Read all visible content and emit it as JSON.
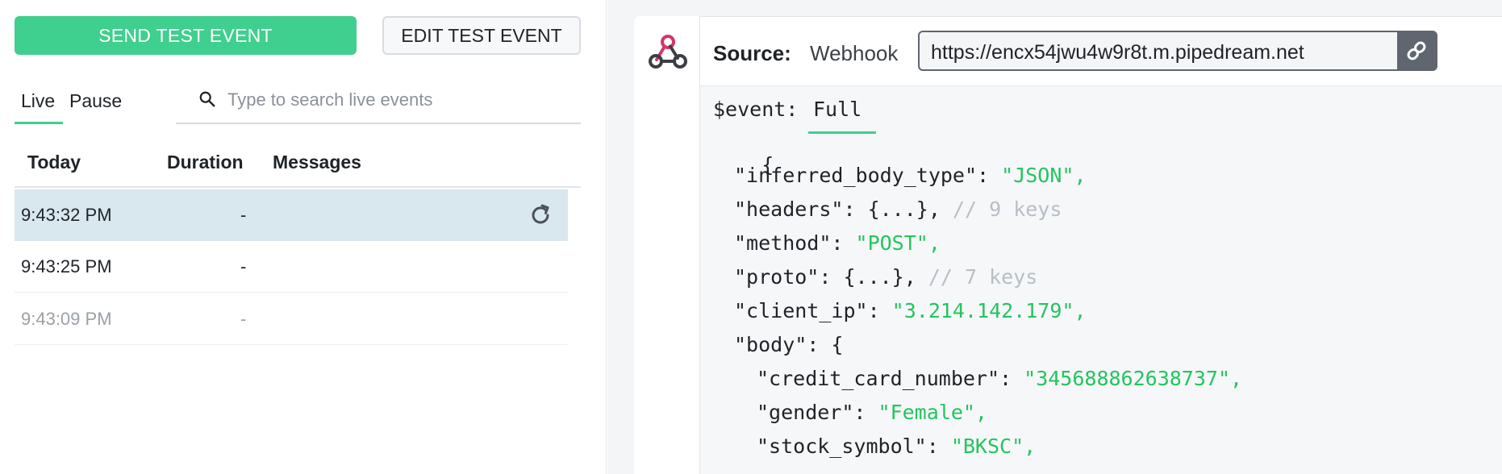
{
  "toolbar": {
    "send_label": "SEND TEST EVENT",
    "edit_label": "EDIT TEST EVENT"
  },
  "tabs": {
    "live": "Live",
    "pause": "Pause",
    "active": "Live"
  },
  "search": {
    "placeholder": "Type to search live events"
  },
  "events_table": {
    "headers": [
      "Today",
      "Duration",
      "Messages"
    ],
    "rows": [
      {
        "time": "9:43:32 PM",
        "duration": "-",
        "messages": ""
      },
      {
        "time": "9:43:25 PM",
        "duration": "-",
        "messages": ""
      },
      {
        "time": "9:43:09 PM",
        "duration": "-",
        "messages": ""
      }
    ]
  },
  "source": {
    "label": "Source:",
    "type": "Webhook",
    "url": "https://encx54jwu4w9r8t.m.pipedream.net"
  },
  "event_view": {
    "label": "$event:",
    "mode": "Full",
    "lines": {
      "open": "{",
      "inferred_key": "\"inferred_body_type\": ",
      "inferred_val": "\"JSON\",",
      "headers_key": "\"headers\": {...}, ",
      "headers_comment": "// 9 keys",
      "method_key": "\"method\": ",
      "method_val": "\"POST\",",
      "proto_key": "\"proto\": {...}, ",
      "proto_comment": "// 7 keys",
      "ip_key": "\"client_ip\": ",
      "ip_val": "\"3.214.142.179\",",
      "body_key": "\"body\": {",
      "cc_key": "\"credit_card_number\": ",
      "cc_val": "\"345688862638737\",",
      "gender_key": "\"gender\": ",
      "gender_val": "\"Female\",",
      "stock_key": "\"stock_symbol\": ",
      "stock_val": "\"BKSC\","
    }
  },
  "colors": {
    "accent": "#3fcf8e",
    "string": "#22c55e",
    "comment": "#b7bec7",
    "selected_row": "#d9e7ef",
    "webhook_pink": "#d6336c"
  },
  "icons": [
    "search-icon",
    "refresh-icon",
    "webhook-icon",
    "link-icon"
  ]
}
